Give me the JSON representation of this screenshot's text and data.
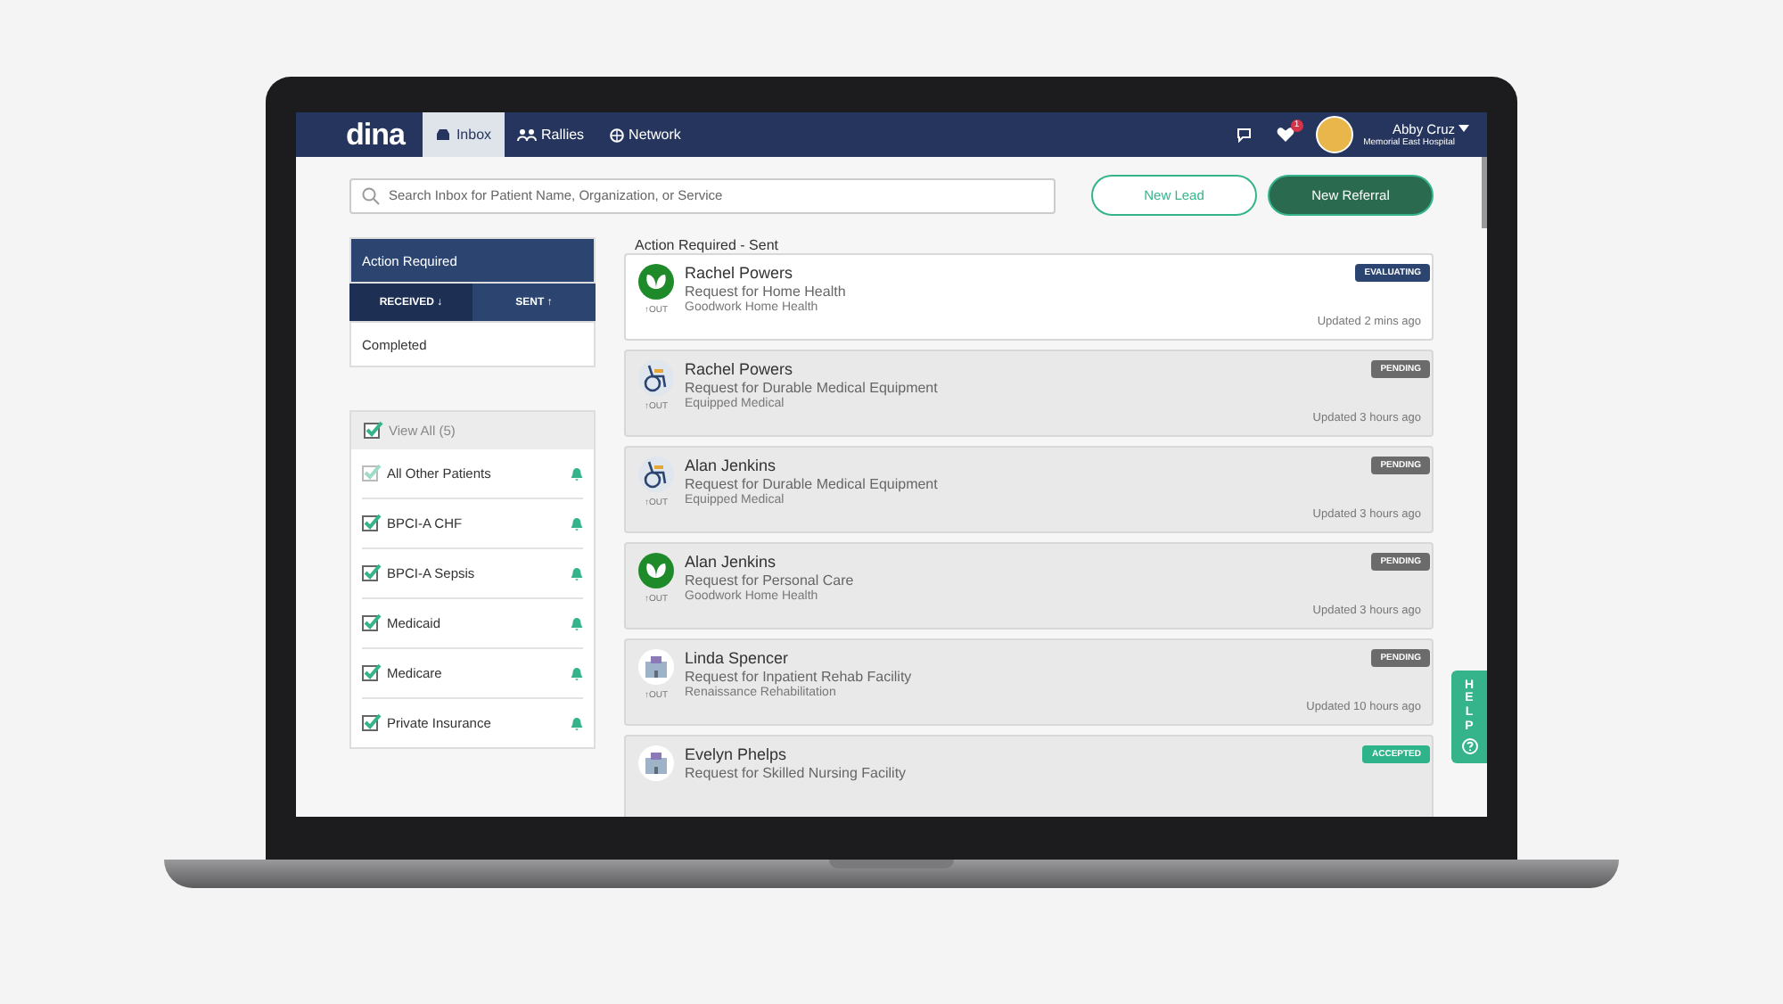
{
  "nav": {
    "logo": "dina",
    "tabs": [
      {
        "label": "Inbox",
        "kind": "inbox",
        "selected": true
      },
      {
        "label": "Rallies",
        "kind": "people",
        "selected": false
      },
      {
        "label": "Network",
        "kind": "globe",
        "selected": false
      }
    ],
    "notification_count": "1",
    "user": {
      "name": "Abby Cruz",
      "organization": "Memorial East Hospital"
    }
  },
  "search": {
    "placeholder": "Search Inbox for Patient Name, Organization, or Service"
  },
  "buttons": [
    {
      "label": "New Lead",
      "kind": "outline"
    },
    {
      "label": "New Referral",
      "kind": "solid"
    }
  ],
  "sidebar": {
    "items": [
      {
        "label": "Action Required",
        "selected": true
      },
      {
        "label": "Completed",
        "selected": false
      }
    ],
    "direction_tabs": [
      {
        "label": "RECEIVED",
        "arrow": "↓",
        "selected": true
      },
      {
        "label": "SENT",
        "arrow": "↑",
        "selected": false
      }
    ],
    "filters": {
      "view_all": {
        "label": "View All (5)",
        "checked": true
      },
      "items": [
        {
          "label": "All Other Patients",
          "checked": true,
          "disabled": true
        },
        {
          "label": "BPCI-A CHF",
          "checked": true,
          "disabled": false
        },
        {
          "label": "BPCI-A Sepsis",
          "checked": true,
          "disabled": false
        },
        {
          "label": "Medicaid",
          "checked": true,
          "disabled": false
        },
        {
          "label": "Medicare",
          "checked": true,
          "disabled": false
        },
        {
          "label": "Private Insurance",
          "checked": true,
          "disabled": false
        }
      ]
    }
  },
  "list": {
    "title": "Action Required - Sent",
    "referrals": [
      {
        "patient": "Rachel Powers",
        "service": "Request for Home Health",
        "provider": "Goodwork Home Health",
        "direction": "OUT",
        "updated": "Updated 2 mins ago",
        "status": "EVALUATING",
        "color": "#2b4470",
        "unread": true,
        "kind": "leaf"
      },
      {
        "patient": "Rachel Powers",
        "service": "Request for Durable Medical Equipment",
        "provider": "Equipped Medical",
        "direction": "OUT",
        "updated": "Updated 3 hours ago",
        "status": "PENDING",
        "color": "#6b6b6b",
        "unread": false,
        "kind": "wheelchair"
      },
      {
        "patient": "Alan Jenkins",
        "service": "Request for Durable Medical Equipment",
        "provider": "Equipped Medical",
        "direction": "OUT",
        "updated": "Updated 3 hours ago",
        "status": "PENDING",
        "color": "#6b6b6b",
        "unread": false,
        "kind": "wheelchair"
      },
      {
        "patient": "Alan Jenkins",
        "service": "Request for Personal Care",
        "provider": "Goodwork Home Health",
        "direction": "OUT",
        "updated": "Updated 3 hours ago",
        "status": "PENDING",
        "color": "#6b6b6b",
        "unread": false,
        "kind": "leaf"
      },
      {
        "patient": "Linda Spencer",
        "service": "Request for Inpatient Rehab Facility",
        "provider": "Renaissance Rehabilitation",
        "direction": "OUT",
        "updated": "Updated 10 hours ago",
        "status": "PENDING",
        "color": "#6b6b6b",
        "unread": false,
        "kind": "building"
      },
      {
        "patient": "Evelyn Phelps",
        "service": "Request for Skilled Nursing Facility",
        "status": "ACCEPTED",
        "color": "#2fb38a",
        "unread": false,
        "kind": "building"
      }
    ]
  },
  "help": {
    "label": "HELP"
  }
}
